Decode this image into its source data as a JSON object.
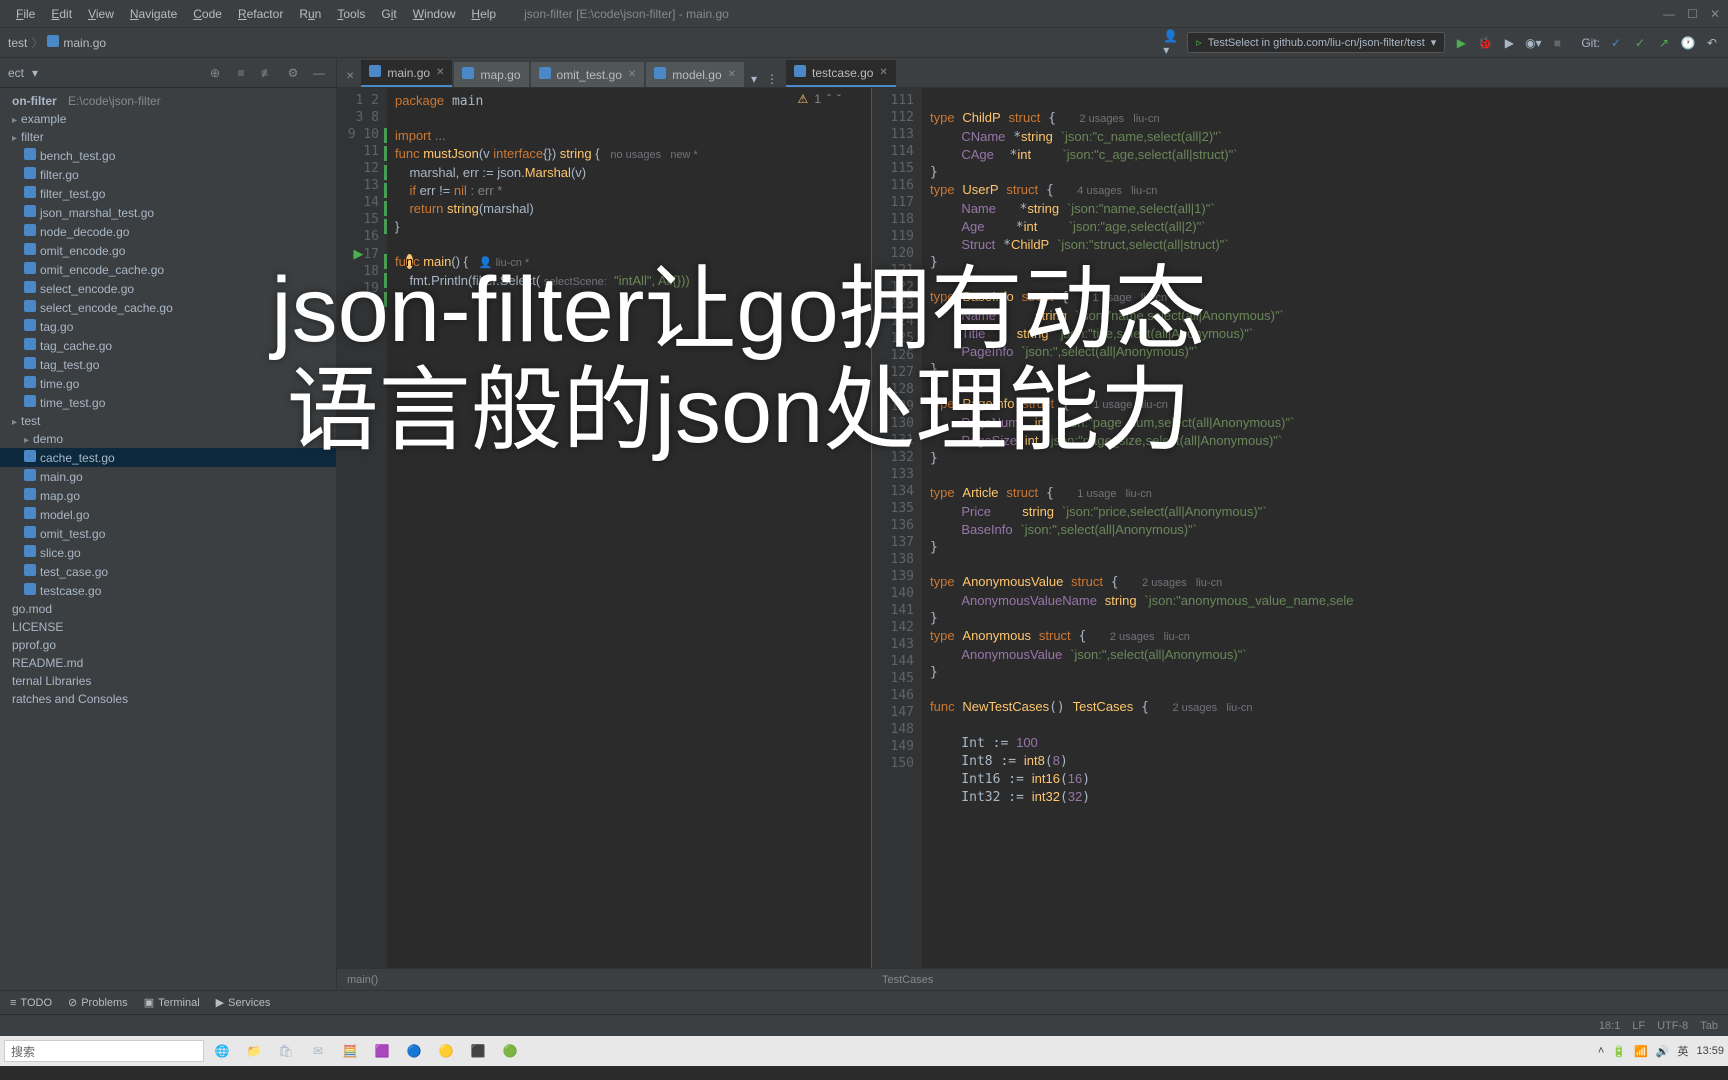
{
  "window": {
    "title": "json-filter [E:\\code\\json-filter] - main.go"
  },
  "menu": [
    "File",
    "Edit",
    "View",
    "Navigate",
    "Code",
    "Refactor",
    "Run",
    "Tools",
    "Git",
    "Window",
    "Help"
  ],
  "breadcrumb": {
    "parent": "test",
    "file": "main.go"
  },
  "runConfig": "TestSelect in github.com/liu-cn/json-filter/test",
  "gitLabel": "Git:",
  "sidebar": {
    "project_select": "ect",
    "root": {
      "name": "on-filter",
      "path": "E:\\code\\json-filter"
    },
    "folders": {
      "example": "example",
      "filter": "filter",
      "test": "test",
      "demo": "demo"
    },
    "filter_files": [
      "bench_test.go",
      "filter.go",
      "filter_test.go",
      "json_marshal_test.go",
      "node_decode.go",
      "omit_encode.go",
      "omit_encode_cache.go",
      "select_encode.go",
      "select_encode_cache.go",
      "tag.go",
      "tag_cache.go",
      "tag_test.go",
      "time.go",
      "time_test.go"
    ],
    "test_files": [
      "cache_test.go",
      "main.go",
      "map.go",
      "model.go",
      "omit_test.go",
      "slice.go",
      "test_case.go",
      "testcase.go"
    ],
    "root_files": [
      "go.mod",
      "LICENSE",
      "pprof.go",
      "README.md"
    ],
    "special": [
      "ternal Libraries",
      "ratches and Consoles"
    ]
  },
  "tabs": {
    "left": [
      {
        "name": "main.go",
        "active": true
      },
      {
        "name": "map.go",
        "active": false
      },
      {
        "name": "omit_test.go",
        "active": false
      },
      {
        "name": "model.go",
        "active": false
      }
    ],
    "right": [
      {
        "name": "testcase.go",
        "active": true
      }
    ]
  },
  "editor_left": {
    "lines": [
      "1",
      "2",
      "3",
      "8",
      "9",
      "10",
      "11",
      "12",
      "13",
      "14",
      "15",
      "16",
      "17",
      "18",
      "19"
    ],
    "warn_count": "1",
    "code": {
      "l1": "package main",
      "l3": "import ...",
      "l9": "func mustJson(v interface{}) string {",
      "l9_hint": "no usages   new *",
      "l10": "    marshal, err := json.Marshal(v)",
      "l11": "    if err != nil : err *",
      "l12": "    return string(marshal)",
      "l13": "}",
      "l16": "func main() {",
      "l16_hint": "liu-cn *",
      "l18_a": "    fmt.Println(filter.Select(",
      "l18_hint": "selectScene:",
      "l18_b": "  \"intAll\", All{}))",
      "l19": "}"
    },
    "status": "main()"
  },
  "editor_right": {
    "lines": [
      "111",
      "112",
      "113",
      "114",
      "115",
      "116",
      "117",
      "118",
      "119",
      "120",
      "121",
      "122",
      "123",
      "124",
      "125",
      "126",
      "127",
      "128",
      "129",
      "130",
      "131",
      "132",
      "133",
      "134",
      "135",
      "136",
      "137",
      "138",
      "139",
      "140",
      "141",
      "142",
      "143",
      "144",
      "145",
      "146",
      "147",
      "148",
      "149",
      "150"
    ],
    "code": {
      "childp": "type ChildP struct {",
      "childp_u": "2 usages   liu-cn",
      "cname": "    CName *string `json:\"c_name,select(all|2)\"`",
      "cage": "    CAge  *int    `json:\"c_age,select(all|struct)\"`",
      "close1": "}",
      "userp": "type UserP struct {",
      "userp_u": "4 usages   liu-cn",
      "uname": "    Name   *string `json:\"name,select(all|1)\"`",
      "uage": "    Age    *int    `json:\"age,select(all|2)\"`",
      "ustruct": "    Struct *ChildP `json:\"struct,select(all|struct)\"`",
      "baseinfo": "type BaseInfo struct {",
      "baseinfo_u": "1 usage   liu-cn",
      "bname": "    Name     string `json:\"name,select(all|Anonymous)\"`",
      "btitle": "    Title    string `json:\"title,select(all|Anonymous)\"`",
      "bpage": "    PageInfo `json:\",select(all|Anonymous)\"`",
      "pageinfo": "type PageInfo struct {",
      "pageinfo_u": "1 usage   liu-cn",
      "pnum": "    PageNum  int `json:\"page_num,select(all|Anonymous)\"`",
      "psize": "    PageSize int `json:\"page_size,select(all|Anonymous)\"`",
      "article": "type Article struct {",
      "article_u": "1 usage   liu-cn",
      "price": "    Price    string `json:\"price,select(all|Anonymous)\"`",
      "abaseinfo": "    BaseInfo `json:\",select(all|Anonymous)\"`",
      "anonval": "type AnonymousValue struct {",
      "anonval_u": "2 usages   liu-cn",
      "anonvalname": "    AnonymousValueName string `json:\"anonymous_value_name,sele",
      "anon": "type Anonymous struct {",
      "anon_u": "2 usages   liu-cn",
      "anonv": "    AnonymousValue `json:\",select(all|Anonymous)\"`",
      "newtc": "func NewTestCases() TestCases {",
      "newtc_u": "2 usages   liu-cn",
      "int_": "    Int := 100",
      "int8": "    Int8 := int8(8)",
      "int16": "    Int16 := int16(16)",
      "int32": "    Int32 := int32(32)"
    },
    "status": "TestCases"
  },
  "overlay": {
    "line1": "json-filter让go拥有动态",
    "line2": "语言般的json处理能力"
  },
  "bottom": {
    "todo": "TODO",
    "problems": "Problems",
    "terminal": "Terminal",
    "services": "Services"
  },
  "ide_status": {
    "pos": "18:1",
    "lf": "LF",
    "enc": "UTF-8",
    "indent": "Tab"
  },
  "taskbar": {
    "search": "搜索",
    "time": "13:59"
  }
}
